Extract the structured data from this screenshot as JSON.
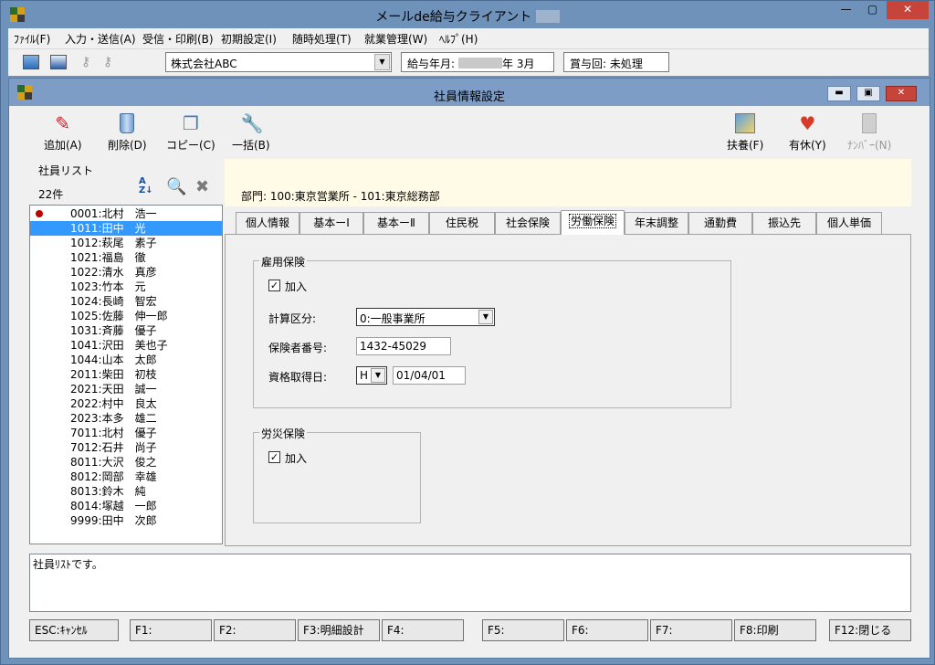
{
  "app": {
    "title": "メールde給与クライアント",
    "menus": [
      "ﾌｧｲﾙ(F)",
      "入力・送信(A)",
      "受信・印刷(B)",
      "初期設定(I)",
      "随時処理(T)",
      "就業管理(W)",
      "ﾍﾙﾌﾟ(H)"
    ]
  },
  "toolbar": {
    "company": "株式会社ABC",
    "pay_month_label": "給与年月:",
    "pay_month_suffix": "年  3月",
    "bonus_label": "賞与回:",
    "bonus_value": "未処理"
  },
  "window": {
    "title": "社員情報設定"
  },
  "actions": {
    "add": "追加(A)",
    "delete": "削除(D)",
    "copy": "コピー(C)",
    "batch": "一括(B)",
    "dependents": "扶養(F)",
    "leave": "有休(Y)",
    "number": "ﾅﾝﾊﾞｰ(N)"
  },
  "employee_list": {
    "title": "社員リスト",
    "count": "22件",
    "items": [
      {
        "code": "0001",
        "name": "北村　浩一",
        "marked": true
      },
      {
        "code": "1011",
        "name": "田中　光",
        "selected": true
      },
      {
        "code": "1012",
        "name": "萩尾　素子"
      },
      {
        "code": "1021",
        "name": "福島　徹"
      },
      {
        "code": "1022",
        "name": "清水　真彦"
      },
      {
        "code": "1023",
        "name": "竹本　元"
      },
      {
        "code": "1024",
        "name": "長崎　智宏"
      },
      {
        "code": "1025",
        "name": "佐藤　伸一郎"
      },
      {
        "code": "1031",
        "name": "斉藤　優子"
      },
      {
        "code": "1041",
        "name": "沢田　美也子"
      },
      {
        "code": "1044",
        "name": "山本　太郎"
      },
      {
        "code": "2011",
        "name": "柴田　初枝"
      },
      {
        "code": "2021",
        "name": "天田　誠一"
      },
      {
        "code": "2022",
        "name": "村中　良太"
      },
      {
        "code": "2023",
        "name": "本多　雄二"
      },
      {
        "code": "7011",
        "name": "北村　優子"
      },
      {
        "code": "7012",
        "name": "石井　尚子"
      },
      {
        "code": "8011",
        "name": "大沢　俊之"
      },
      {
        "code": "8012",
        "name": "岡部　幸雄"
      },
      {
        "code": "8013",
        "name": "鈴木　純"
      },
      {
        "code": "8014",
        "name": "塚越　一郎"
      },
      {
        "code": "9999",
        "name": "田中　次郎"
      }
    ]
  },
  "department": "部門:  100:東京営業所 - 101:東京総務部",
  "tabs": [
    "個人情報",
    "基本ーⅠ",
    "基本ーⅡ",
    "住民税",
    "社会保険",
    "労働保険",
    "年末調整",
    "通勤費",
    "振込先",
    "個人単価"
  ],
  "active_tab": "労働保険",
  "employment_insurance": {
    "title": "雇用保険",
    "enroll_label": "加入",
    "enrolled": true,
    "calc_label": "計算区分:",
    "calc_value": "0:一般事業所",
    "insured_no_label": "保険者番号:",
    "insured_no_value": "1432-45029",
    "acquired_label": "資格取得日:",
    "era": "H",
    "acquired_value": "01/04/01"
  },
  "workers_comp": {
    "title": "労災保険",
    "enroll_label": "加入",
    "enrolled": true
  },
  "status_message": "社員ﾘｽﾄです。",
  "function_keys": [
    "ESC:ｷｬﾝｾﾙ",
    "F1:",
    "F2:",
    "F3:明細設計",
    "F4:",
    "F5:",
    "F6:",
    "F7:",
    "F8:印刷",
    "F12:閉じる"
  ]
}
